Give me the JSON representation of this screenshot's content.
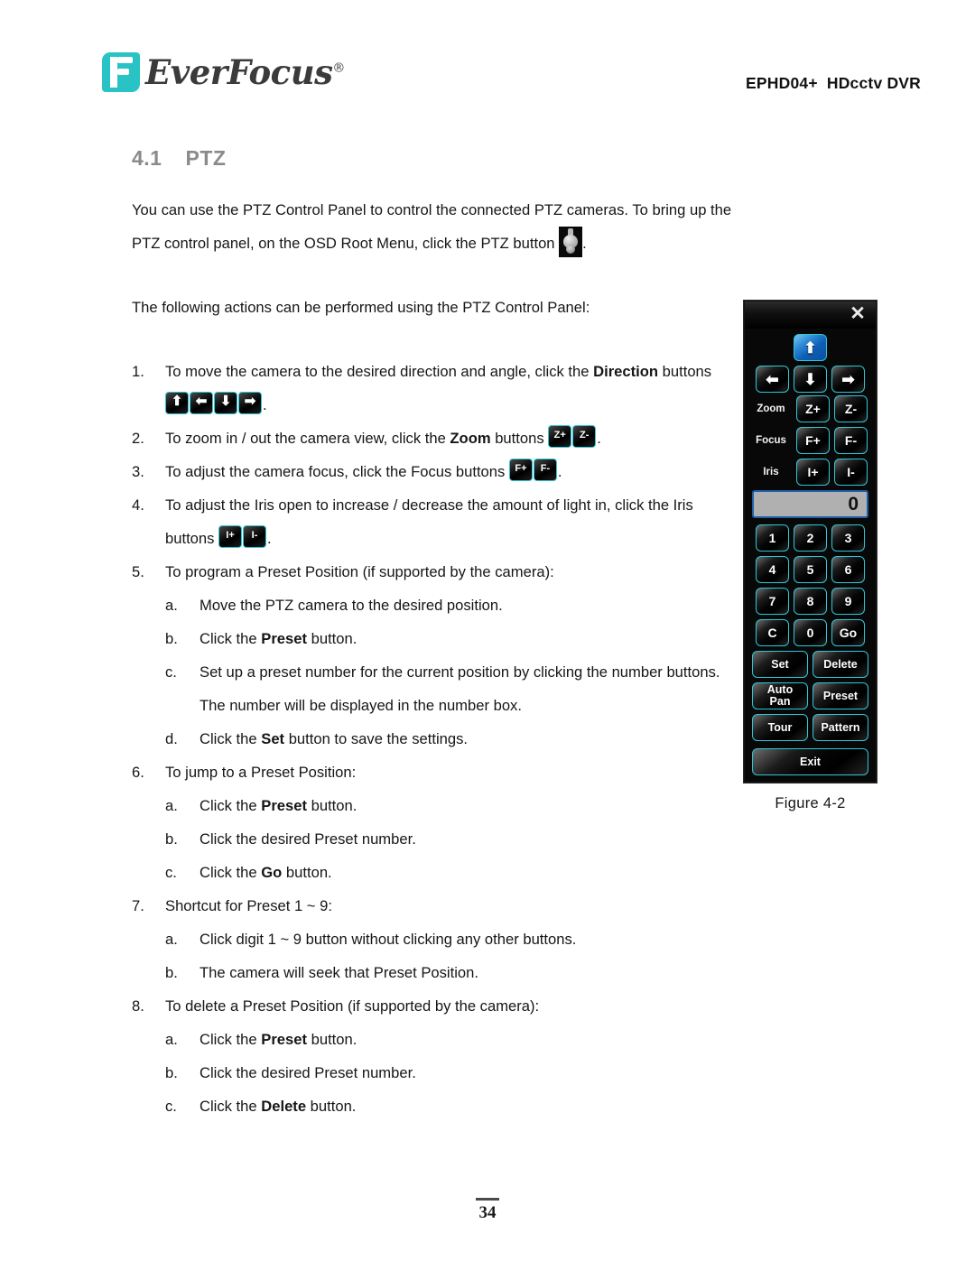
{
  "header": {
    "logo_text": "EverFocus",
    "logo_registered": "®",
    "product": "EPHD04+  HDcctv DVR"
  },
  "section": {
    "number": "4.1",
    "title": "PTZ"
  },
  "intro": {
    "part1": "You can use the PTZ Control Panel to control the connected PTZ cameras. To bring up the PTZ control panel, on the OSD Root Menu, click the PTZ button ",
    "part2": ".",
    "lead_in": "The following actions can be performed using the PTZ Control Panel:"
  },
  "steps": [
    {
      "marker": "1.",
      "text_before": "To move the camera to the desired direction and angle, click the ",
      "bold": "Direction",
      "text_after": " buttons ",
      "icons": [
        "⬆",
        "⬅",
        "⬇",
        "➡"
      ],
      "text_end": "."
    },
    {
      "marker": "2.",
      "text_before": "To zoom in / out the camera view, click the ",
      "bold": "Zoom",
      "text_after": " buttons ",
      "icons": [
        "Z+",
        "Z-"
      ],
      "text_end": "."
    },
    {
      "marker": "3.",
      "text_before": "To adjust the camera focus, click the Focus buttons ",
      "bold": "",
      "text_after": "",
      "icons": [
        "F+",
        "F-"
      ],
      "text_end": "."
    },
    {
      "marker": "4.",
      "text_before": "To adjust the Iris open to increase / decrease the amount of light in, click the Iris buttons ",
      "bold": "",
      "text_after": "",
      "icons": [
        "I+",
        "I-"
      ],
      "text_end": "."
    },
    {
      "marker": "5.",
      "text_before": "To program a Preset Position (if supported by the camera):",
      "bold": "",
      "text_after": "",
      "icons": [],
      "text_end": "",
      "sub": [
        {
          "marker": "a.",
          "pre": "Move the PTZ camera to the desired position.",
          "bold": "",
          "post": ""
        },
        {
          "marker": "b.",
          "pre": "Click the ",
          "bold": "Preset",
          "post": " button."
        },
        {
          "marker": "c.",
          "pre": "Set up a preset number for the current position by clicking the number buttons. The number will be displayed in the number box.",
          "bold": "",
          "post": ""
        },
        {
          "marker": "d.",
          "pre": "Click the ",
          "bold": "Set",
          "post": " button to save the settings."
        }
      ]
    },
    {
      "marker": "6.",
      "text_before": "To jump to a Preset Position:",
      "bold": "",
      "text_after": "",
      "icons": [],
      "text_end": "",
      "sub": [
        {
          "marker": "a.",
          "pre": "Click the ",
          "bold": "Preset",
          "post": " button."
        },
        {
          "marker": "b.",
          "pre": "Click the desired Preset number.",
          "bold": "",
          "post": ""
        },
        {
          "marker": "c.",
          "pre": "Click the ",
          "bold": "Go",
          "post": " button."
        }
      ]
    },
    {
      "marker": "7.",
      "text_before": "Shortcut for Preset 1 ~ 9:",
      "bold": "",
      "text_after": "",
      "icons": [],
      "text_end": "",
      "sub": [
        {
          "marker": "a.",
          "pre": "Click digit 1 ~ 9 button without clicking any other buttons.",
          "bold": "",
          "post": ""
        },
        {
          "marker": "b.",
          "pre": "The camera will seek that Preset Position.",
          "bold": "",
          "post": ""
        }
      ]
    },
    {
      "marker": "8.",
      "text_before": "To delete a Preset Position (if supported by the camera):",
      "bold": "",
      "text_after": "",
      "icons": [],
      "text_end": "",
      "sub": [
        {
          "marker": "a.",
          "pre": "Click the ",
          "bold": "Preset",
          "post": " button."
        },
        {
          "marker": "b.",
          "pre": "Click the desired Preset number.",
          "bold": "",
          "post": ""
        },
        {
          "marker": "c.",
          "pre": "Click the ",
          "bold": "Delete",
          "post": " button."
        }
      ]
    }
  ],
  "ptz_panel": {
    "close_glyph": "✕",
    "dpad": {
      "up": "⬆",
      "left": "⬅",
      "down": "⬇",
      "right": "➡",
      "selected": "up"
    },
    "zoom_label": "Zoom",
    "zoom_in": "Z+",
    "zoom_out": "Z-",
    "focus_label": "Focus",
    "focus_in": "F+",
    "focus_out": "F-",
    "iris_label": "Iris",
    "iris_in": "I+",
    "iris_out": "I-",
    "number_display": "0",
    "keypad": [
      "1",
      "2",
      "3",
      "4",
      "5",
      "6",
      "7",
      "8",
      "9",
      "C",
      "0",
      "Go"
    ],
    "functions": [
      "Set",
      "Delete",
      "Auto\nPan",
      "Preset",
      "Tour",
      "Pattern"
    ],
    "exit": "Exit",
    "accent_border": "#2ec6d6",
    "selected_color": "#1268bd",
    "display_bg": "#b0b0b0"
  },
  "figure": {
    "caption": "Figure 4-2"
  },
  "footer": {
    "page_number": "34"
  }
}
